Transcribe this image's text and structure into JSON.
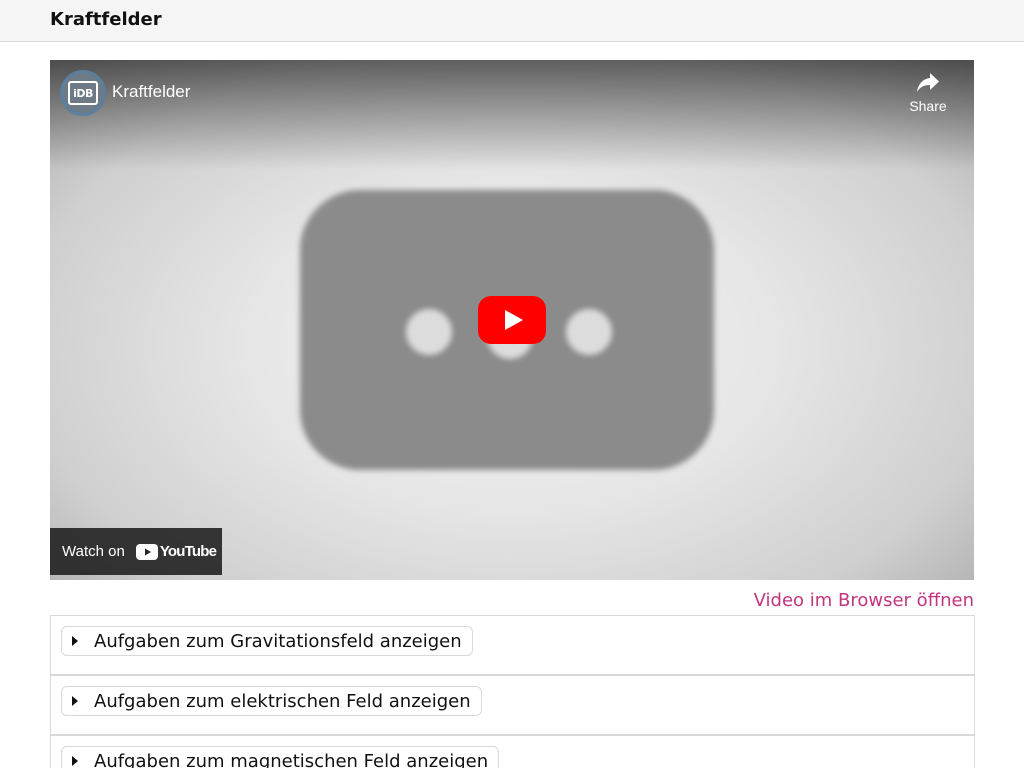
{
  "page": {
    "title": "Kraftfelder"
  },
  "video": {
    "title": "Kraftfelder",
    "channel_avatar_text": "iDB",
    "share_label": "Share",
    "watch_on_label": "Watch on",
    "youtube_wordmark": "YouTube",
    "play_icon": "youtube-play-icon"
  },
  "open_in_browser_label": "Video im Browser öffnen",
  "panels": [
    {
      "label": "Aufgaben zum Gravitationsfeld anzeigen",
      "expanded": false
    },
    {
      "label": "Aufgaben zum elektrischen Feld anzeigen",
      "expanded": false
    },
    {
      "label": "Aufgaben zum magnetischen Feld anzeigen",
      "expanded": false
    }
  ],
  "colors": {
    "link": "#c2357f",
    "youtube_red": "#ff0000",
    "header_bg": "#f5f5f5"
  }
}
